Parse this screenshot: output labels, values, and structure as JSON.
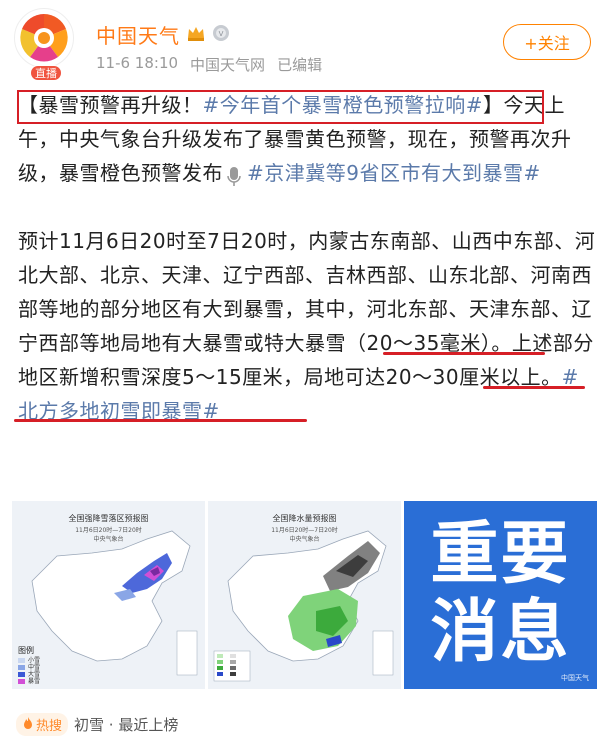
{
  "header": {
    "user_name": "中国天气",
    "live_badge": "直播",
    "time": "11-6 18:10",
    "source": "中国天气网",
    "edited": "已编辑",
    "follow_label": "+关注"
  },
  "post": {
    "p1_bracket_open": "【",
    "p1_title": "暴雪预警再升级！",
    "p1_topic1": "#今年首个暴雪橙色预警拉响#",
    "p1_bracket_close": "】",
    "p1_body": "今天上午，中央气象台升级发布了暴雪黄色预警，现在，预警再次升级，暴雪橙色预警发布",
    "p1_topic2": "#京津冀等9省区市有大到暴雪#",
    "p2_part1": "预计11月6日20时至7日20时，内蒙古东南部、山西中东部、河北大部、北京、天津、辽宁西部、吉林西部、山东北部、河南西部等地的部分地区有大到暴雪，其中，河北东部、天津东部、辽宁西部等地局地有大暴雪或特大暴雪（20～35毫米）。上述部分地区新增积雪深度5～15厘米，局地可达20～30厘米以上。",
    "p2_topic": "#北方多地初雪即暴雪#"
  },
  "images": {
    "map1": {
      "title": "全国强降雪落区预报图",
      "sub": "11月6日20时—7日20时",
      "org": "中央气象台",
      "legend_title": "图例",
      "legend": [
        {
          "label": "小雪",
          "color": "#c9d7f0"
        },
        {
          "label": "中雪",
          "color": "#8aa6e6"
        },
        {
          "label": "大雪",
          "color": "#3a58d6"
        },
        {
          "label": "暴雪",
          "color": "#d14fd6"
        },
        {
          "label": "大暴雪",
          "color": "#7a2aa0"
        }
      ]
    },
    "map2": {
      "title": "全国降水量预报图",
      "sub": "11月6日20时—7日20时",
      "org": "中央气象台"
    },
    "card": {
      "line1": "重要",
      "line2": "消息",
      "watermark": "中国天气"
    }
  },
  "footer": {
    "hot_badge": "热搜",
    "hot_text": "初雪 · 最近上榜"
  },
  "colors": {
    "accent_orange": "#ff8200",
    "topic_blue": "#5b7aaa",
    "highlight_red": "#d61f26",
    "card_blue": "#2a6ed6"
  }
}
